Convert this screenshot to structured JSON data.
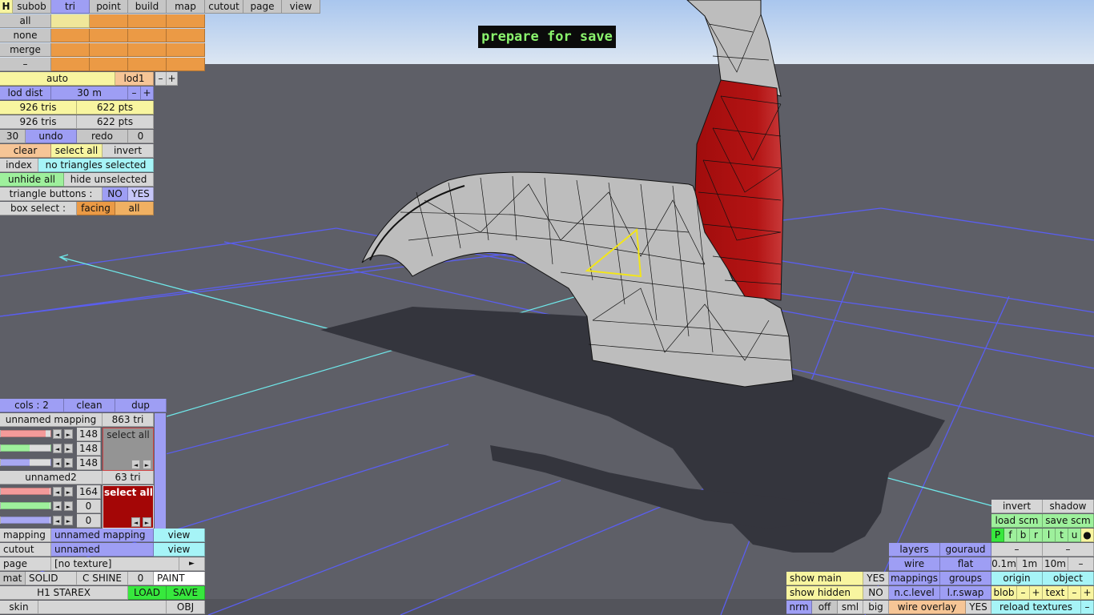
{
  "banner": "prepare for save",
  "top_menu": {
    "h": "H",
    "items": [
      "subob",
      "tri",
      "point",
      "build",
      "map",
      "cutout",
      "page",
      "view"
    ]
  },
  "select_buttons": [
    "all",
    "none",
    "merge",
    "–"
  ],
  "lod": {
    "auto": "auto",
    "level": "lod1",
    "minus": "–",
    "plus": "+",
    "dist_label": "lod dist",
    "dist_value": "30 m",
    "tris1": "926 tris",
    "pts1": "622 pts",
    "tris2": "926 tris",
    "pts2": "622 pts"
  },
  "undo_row": {
    "count": "30",
    "undo": "undo",
    "redo": "redo",
    "redo_count": "0"
  },
  "selection": {
    "clear": "clear",
    "select_all": "select all",
    "invert": "invert",
    "index": "index",
    "status": "no triangles selected",
    "unhide_all": "unhide all",
    "hide_unselected": "hide unselected",
    "triangle_buttons": "triangle buttons :",
    "tb_no": "NO",
    "tb_yes": "YES",
    "box_select": "box select :",
    "facing": "facing",
    "all": "all"
  },
  "colors_panel": {
    "cols": "cols : 2",
    "clean": "clean",
    "dup": "dup",
    "group1": {
      "name": "unnamed mapping",
      "tris": "863 tri",
      "values": [
        "148",
        "148",
        "148"
      ],
      "select_all": "select all"
    },
    "group2": {
      "name": "unnamed2",
      "tris": "63 tri",
      "values": [
        "164",
        "0",
        "0"
      ],
      "select_all": "select all"
    }
  },
  "mapping": {
    "mapping_label": "mapping",
    "mapping_value": "unnamed mapping",
    "mapping_view": "view",
    "cutout_label": "cutout",
    "cutout_value": "unnamed",
    "cutout_view": "view",
    "page_label": "page",
    "page_value": "[no texture]",
    "page_arrow": "►",
    "mat": "mat",
    "solid": "SOLID",
    "cshine": "C SHINE",
    "zero": "0",
    "paint": "PAINT",
    "file": "H1 STAREX",
    "load": "LOAD",
    "save": "SAVE",
    "skin": "skin",
    "obj": "OBJ"
  },
  "right_panel": {
    "invert": "invert",
    "shadow": "shadow",
    "load_scm": "load scm",
    "save_scm": "save scm",
    "letters": [
      "P",
      "f",
      "b",
      "r",
      "l",
      "t",
      "u",
      "●"
    ],
    "layers": "layers",
    "gouraud": "gouraud",
    "dash1": "–",
    "dash2": "–",
    "wire": "wire",
    "flat": "flat",
    "size1": "0.1m",
    "size2": "1m",
    "size3": "10m",
    "size_dash": "–",
    "show_main": "show main",
    "show_main_val": "YES",
    "mappings": "mappings",
    "groups": "groups",
    "origin": "origin",
    "object": "object",
    "show_hidden": "show hidden",
    "show_hidden_val": "NO",
    "nclevel": "n.c.level",
    "lrswap": "l.r.swap",
    "blob": "blob",
    "blob_minus": "–",
    "blob_plus": "+",
    "text": "text",
    "text_minus": "–",
    "text_plus": "+",
    "nrm": "nrm",
    "off": "off",
    "sml": "sml",
    "big": "big",
    "wire_overlay": "wire overlay",
    "wire_overlay_val": "YES",
    "reload_textures": "reload textures",
    "reload_dash": "–"
  },
  "colors": {
    "sky_top": "#a9c6ee",
    "sky_bottom": "#d8e4f2",
    "ground": "#5e5f67",
    "grid": "#5a5ef0",
    "mesh_fill": "#bdbdbd",
    "mesh_red": "#b01010",
    "selection": "#ffee00"
  }
}
